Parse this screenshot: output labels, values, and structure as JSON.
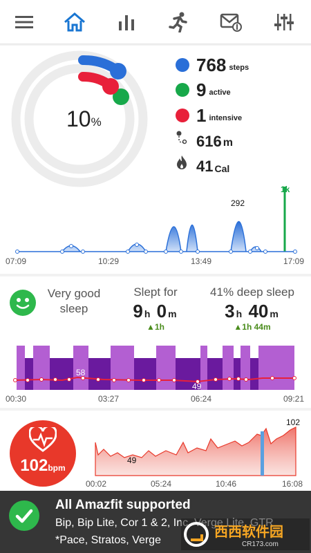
{
  "nav": {
    "items": [
      {
        "icon": "menu-icon"
      },
      {
        "icon": "home-icon",
        "active": true
      },
      {
        "icon": "bar-chart-icon"
      },
      {
        "icon": "running-icon"
      },
      {
        "icon": "notification-mail-icon"
      },
      {
        "icon": "settings-sliders-icon"
      }
    ],
    "accent": "#1976d2"
  },
  "activity": {
    "percent": "10",
    "percent_unit": "%",
    "steps_value": "768",
    "steps_unit": "steps",
    "active_value": "9",
    "active_unit": "active",
    "intensive_value": "1",
    "intensive_unit": "intensive",
    "distance_value": "616",
    "distance_unit": "m",
    "calories_value": "41",
    "calories_unit": "Cal",
    "colors": {
      "steps": "#2a6fd8",
      "active": "#17a84a",
      "intensive": "#e8203a"
    }
  },
  "steps_chart": {
    "peak_label": "292",
    "goal_label": "1k",
    "x_labels": [
      "07:09",
      "10:29",
      "13:49",
      "17:09"
    ]
  },
  "sleep": {
    "quality_label": "Very good sleep",
    "slept_title": "Slept for",
    "slept_h": "9",
    "slept_m": "0",
    "slept_delta": "1h",
    "deep_title": "41% deep sleep",
    "deep_h": "3",
    "deep_m": "40",
    "deep_delta": "1h 44m",
    "unit_h": "h",
    "unit_m": "m",
    "hr_high_label": "58",
    "hr_low_label": "49",
    "x_labels": [
      "00:30",
      "03:27",
      "06:24",
      "09:21"
    ]
  },
  "heart": {
    "bpm_value": "102",
    "bpm_unit": "bpm",
    "max_label": "102",
    "min_label": "49",
    "x_labels": [
      "00:02",
      "05:24",
      "10:46",
      "16:08"
    ]
  },
  "banner": {
    "title": "All Amazfit supported",
    "line1": "Bip, Bip Lite, Cor 1 & 2, Inc, Verge Lite, GTR",
    "line2": "*Pace, Stratos, Verge",
    "watermark": "西西软件园",
    "watermark_sub": "CR173.com"
  }
}
